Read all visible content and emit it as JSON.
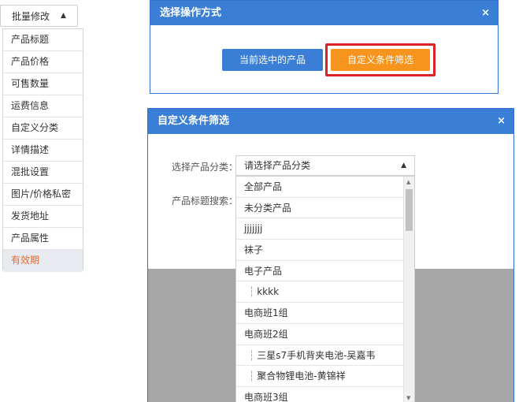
{
  "batch": {
    "button_label": "批量修改",
    "caret": "▲",
    "items": [
      {
        "label": "产品标题"
      },
      {
        "label": "产品价格"
      },
      {
        "label": "可售数量"
      },
      {
        "label": "运费信息"
      },
      {
        "label": "自定义分类"
      },
      {
        "label": "详情描述"
      },
      {
        "label": "混批设置"
      },
      {
        "label": "图片/价格私密"
      },
      {
        "label": "发货地址"
      },
      {
        "label": "产品属性"
      },
      {
        "label": "有效期"
      }
    ],
    "active_index": 10,
    "active_color": "#e8692c"
  },
  "dialog_operation": {
    "title": "选择操作方式",
    "close": "×",
    "btn_current": "当前选中的产品",
    "btn_custom": "自定义条件筛选",
    "colors": {
      "header": "#3a7fd5",
      "primary": "#3a7fd5",
      "orange": "#f7941d",
      "highlight": "#d9222a"
    }
  },
  "dialog_filter": {
    "title": "自定义条件筛选",
    "close": "×",
    "category_label": "选择产品分类：",
    "title_search_label": "产品标题搜索：",
    "select_placeholder": "请选择产品分类",
    "select_caret": "▲",
    "options": [
      {
        "label": "全部产品",
        "child": false
      },
      {
        "label": "未分类产品",
        "child": false
      },
      {
        "label": "jjjjjjj",
        "child": false
      },
      {
        "label": "袜子",
        "child": false
      },
      {
        "label": "电子产品",
        "child": false
      },
      {
        "label": "kkkk",
        "child": true
      },
      {
        "label": "电商班1组",
        "child": false
      },
      {
        "label": "电商班2组",
        "child": false
      },
      {
        "label": "三星s7手机背夹电池-吴嘉韦",
        "child": true
      },
      {
        "label": "聚合物锂电池-黄锦祥",
        "child": true
      },
      {
        "label": "电商班3组",
        "child": false
      }
    ],
    "tree_glyph": "┆",
    "scroll_up": "▲",
    "scroll_down": "▼"
  }
}
